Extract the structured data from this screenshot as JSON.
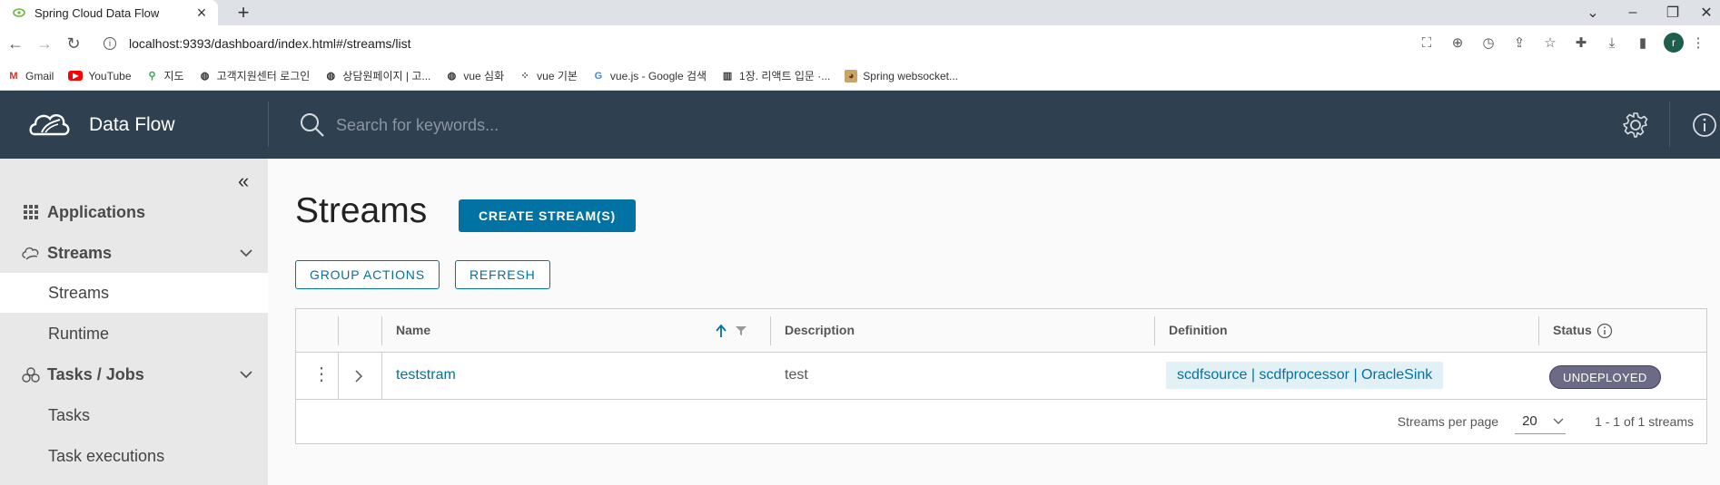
{
  "browser": {
    "tab_title": "Spring Cloud Data Flow",
    "url": "localhost:9393/dashboard/index.html#/streams/list",
    "bookmarks": [
      {
        "label": "Gmail",
        "icon": "gmail-icon"
      },
      {
        "label": "YouTube",
        "icon": "youtube-icon"
      },
      {
        "label": "지도",
        "icon": "maps-icon"
      },
      {
        "label": "고객지원센터 로그인",
        "icon": "globe-icon"
      },
      {
        "label": "상담원페이지 | 고...",
        "icon": "globe-icon"
      },
      {
        "label": "vue 심화",
        "icon": "globe-icon"
      },
      {
        "label": "vue 기본",
        "icon": "dots-icon"
      },
      {
        "label": "vue.js - Google 검색",
        "icon": "google-icon"
      },
      {
        "label": "1장. 리액트 입문 ·...",
        "icon": "book-icon"
      },
      {
        "label": "Spring websocket...",
        "icon": "dog-icon"
      }
    ],
    "profile_initial": "r"
  },
  "header": {
    "brand": "Data Flow",
    "search_placeholder": "Search for keywords..."
  },
  "sidebar": {
    "items": [
      {
        "label": "Applications",
        "type": "group"
      },
      {
        "label": "Streams",
        "type": "group"
      },
      {
        "label": "Streams",
        "type": "sub",
        "active": true
      },
      {
        "label": "Runtime",
        "type": "sub"
      },
      {
        "label": "Tasks / Jobs",
        "type": "group"
      },
      {
        "label": "Tasks",
        "type": "sub"
      },
      {
        "label": "Task executions",
        "type": "sub"
      }
    ]
  },
  "main": {
    "title": "Streams",
    "create_button": "CREATE STREAM(S)",
    "group_actions_button": "GROUP ACTIONS",
    "refresh_button": "REFRESH",
    "columns": {
      "name": "Name",
      "description": "Description",
      "definition": "Definition",
      "status": "Status"
    },
    "rows": [
      {
        "name": "teststram",
        "description": "test",
        "definition": "scdfsource | scdfprocessor | OracleSink",
        "status": "UNDEPLOYED"
      }
    ],
    "footer": {
      "per_page_label": "Streams per page",
      "per_page_value": "20",
      "range": "1 - 1 of 1 streams"
    }
  },
  "colors": {
    "header_bg": "#2f4050",
    "primary": "#0072a3",
    "sidebar_bg": "#e8e8e8",
    "chip_bg": "#e1f1f6",
    "status_bg": "#6b6b88"
  }
}
